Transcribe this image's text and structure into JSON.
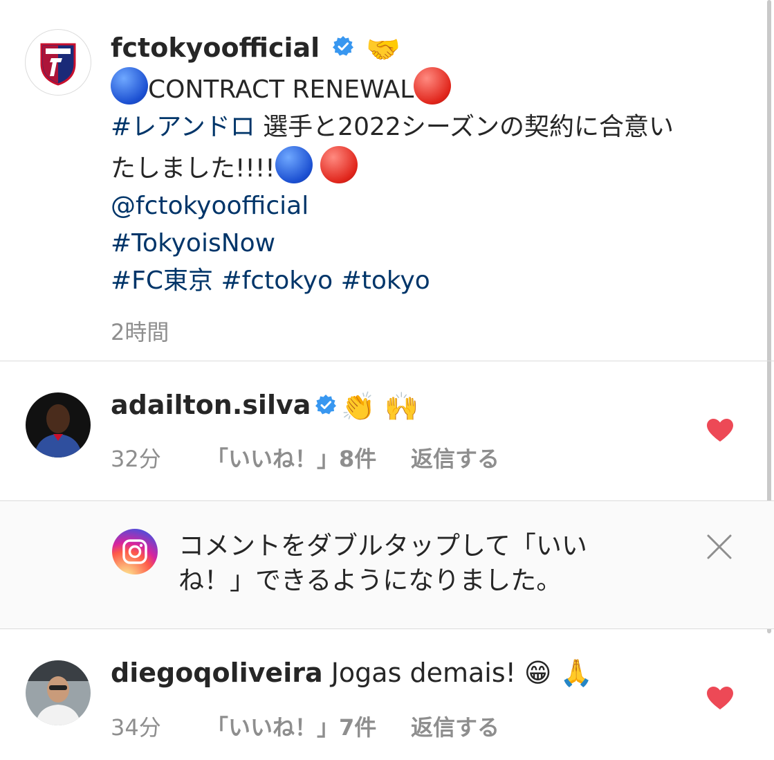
{
  "post": {
    "username": "fctokyoofficial",
    "emoji_after_name": "🤝",
    "line1_text": "CONTRACT RENEWAL",
    "line2_hashtag": "#レアンドロ",
    "line2_text": " 選手と2022シーズンの契約に合意い",
    "line3_text": "たしました!!!!",
    "mention": "@fctokyoofficial",
    "hashtag1": "#TokyoisNow",
    "hashtag2": "#FC東京",
    "hashtag3": "#fctokyo",
    "hashtag4": "#tokyo",
    "time": "2時間"
  },
  "comments": [
    {
      "username": "adailton.silva",
      "text": "👏 🙌",
      "time": "32分",
      "likes": "「いいね！」8件",
      "reply": "返信する"
    },
    {
      "username": "diegoqoliveira",
      "text": "Jogas demais! 😁 🙏",
      "time": "34分",
      "likes": "「いいね！」7件",
      "reply": "返信する"
    }
  ],
  "notice": {
    "text": "コメントをダブルタップして「いいね！」できるようになりました。"
  },
  "colors": {
    "link": "#003569",
    "muted": "#8e8e8e",
    "heart": "#ed4956",
    "verified": "#3897f0"
  },
  "icons": [
    "verified-badge-icon",
    "heart-icon",
    "instagram-icon",
    "close-icon"
  ]
}
